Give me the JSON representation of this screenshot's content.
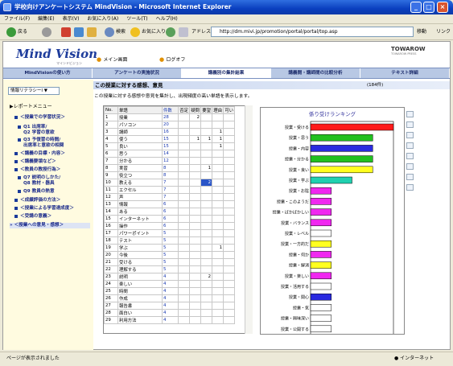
{
  "window": {
    "title": "学校向けアンケートシステム MindVision - Microsoft Internet Explorer"
  },
  "menubar": [
    "ファイル(F)",
    "編集(E)",
    "表示(V)",
    "お気に入り(A)",
    "ツール(T)",
    "ヘルプ(H)"
  ],
  "toolbar": {
    "back": "戻る",
    "search": "検索",
    "favorites": "お気に入り",
    "address_label": "アドレス(D)",
    "address": "http://dm.mivi.jp/promotion/portal/portal/top.asp",
    "go": "移動",
    "links": "リンク"
  },
  "header": {
    "logo": "Mind Vision",
    "logo_sub": "マインドビジョン",
    "menu_main": "メイン画面",
    "logout": "ログオフ",
    "brand": "TOWAROW",
    "brand_sub": "TOWAROW PRESS"
  },
  "navtabs": [
    "MindVisionの使い方",
    "アンケートの実施状況",
    "講義別の集計結果",
    "講義間・講師間の比較分析",
    "テキスト詳細"
  ],
  "sidebar": {
    "select": "情報リテラシーⅠ",
    "menu_title": "▶レポートメニュー",
    "items": [
      "＜授業での学習状況＞",
      "Q1 出席率/",
      "Q2 学習の意欲",
      "Q3 予復習の時間/",
      "出席率と意欲の相関",
      "＜講義の目標・内容＞",
      "＜講義要領など＞",
      "＜教員の教授行為＞",
      "Q7 説明のしかた/",
      "Q8 教材・器具",
      "Q9 教員の熱意",
      "＜成績評価の方法＞",
      "＜授業による学習達成度＞",
      "＜受講の意義＞",
      "＜授業への意見・感想＞"
    ]
  },
  "main": {
    "title": "この授業に対する感想、意見",
    "count": "(184件)",
    "desc": "この授業に対する感想や意見を集計し、出現頻度の高い単語を表示します。",
    "table_headers": [
      "No.",
      "単語",
      "件数",
      "否定",
      "疑問",
      "要望",
      "理由",
      "可い"
    ],
    "rows": [
      [
        "1",
        "授業",
        "28",
        "",
        "2",
        "",
        ""
      ],
      [
        "2",
        "パソコン",
        "20",
        "",
        "",
        "",
        ""
      ],
      [
        "3",
        "講師",
        "16",
        "",
        "",
        "",
        "1"
      ],
      [
        "4",
        "使う",
        "15",
        "",
        "1",
        "1",
        "1"
      ],
      [
        "5",
        "良い",
        "15",
        "",
        "",
        "",
        "1"
      ],
      [
        "6",
        "思う",
        "14",
        "",
        "",
        "",
        ""
      ],
      [
        "7",
        "分かる",
        "12",
        "",
        "",
        "",
        ""
      ],
      [
        "8",
        "実習",
        "8",
        "",
        "",
        "1",
        ""
      ],
      [
        "9",
        "役立つ",
        "8",
        "",
        "",
        "",
        ""
      ],
      [
        "10",
        "教える",
        "7",
        "",
        "",
        "2",
        ""
      ],
      [
        "11",
        "エクセル",
        "7",
        "",
        "",
        "",
        ""
      ],
      [
        "12",
        "声",
        "7",
        "",
        "",
        "",
        ""
      ],
      [
        "13",
        "情報",
        "6",
        "",
        "",
        "",
        ""
      ],
      [
        "14",
        "ある",
        "6",
        "",
        "",
        "",
        ""
      ],
      [
        "15",
        "インターネット",
        "6",
        "",
        "",
        "",
        ""
      ],
      [
        "16",
        "操作",
        "6",
        "",
        "",
        "",
        ""
      ],
      [
        "17",
        "パワーポイント",
        "5",
        "",
        "",
        "",
        ""
      ],
      [
        "18",
        "テスト",
        "5",
        "",
        "",
        "",
        ""
      ],
      [
        "19",
        "学ぶ",
        "5",
        "",
        "",
        "",
        "1"
      ],
      [
        "20",
        "今後",
        "5",
        "",
        "",
        "",
        ""
      ],
      [
        "21",
        "受ける",
        "5",
        "",
        "",
        "",
        ""
      ],
      [
        "22",
        "理解する",
        "5",
        "",
        "",
        "",
        ""
      ],
      [
        "23",
        "説明",
        "4",
        "",
        "",
        "2",
        ""
      ],
      [
        "24",
        "楽しい",
        "4",
        "",
        "",
        "",
        ""
      ],
      [
        "25",
        "時間",
        "4",
        "",
        "",
        "",
        ""
      ],
      [
        "26",
        "作成",
        "4",
        "",
        "",
        "",
        ""
      ],
      [
        "27",
        "報告書",
        "4",
        "",
        "",
        "",
        ""
      ],
      [
        "28",
        "面白い",
        "4",
        "",
        "",
        "",
        ""
      ],
      [
        "29",
        "利用方法",
        "4",
        "",
        "",
        "",
        ""
      ]
    ]
  },
  "chart_data": {
    "type": "bar",
    "title": "係り受けランキング",
    "categories": [
      "授業・受ける",
      "授業・思う",
      "授業・内容",
      "授業・分かる",
      "授業・良い",
      "授業・学ぶ",
      "授業・お陰",
      "授業・このようだ",
      "授業・ばかばかしい",
      "授業・バランス",
      "授業・レベル",
      "授業・一方的だ",
      "授業・何か",
      "授業・解消",
      "授業・楽しい",
      "授業・活用する",
      "授業・関心",
      "授業・気",
      "授業・興味深い",
      "授業・公開する"
    ],
    "values": [
      4,
      3,
      3,
      3,
      3,
      2,
      1,
      1,
      1,
      1,
      1,
      1,
      1,
      1,
      1,
      1,
      1,
      1,
      1,
      1
    ],
    "colors": [
      "#ff1a1a",
      "#20c020",
      "#2a2ae0",
      "#20c020",
      "#ffff20",
      "#20d0b0",
      "#f028f0",
      "#f028f0",
      "#f028f0",
      "#f028f0",
      "#ffffff",
      "#ffff20",
      "#f028f0",
      "#ffff20",
      "#f028f0",
      "#ffffff",
      "#2a2ae0",
      "#ffffff",
      "#ffffff",
      "#ffffff"
    ],
    "xlim": [
      0,
      4
    ],
    "xticks": [
      "0",
      "1",
      "2",
      "3",
      "4"
    ]
  },
  "status": {
    "left": "ページが表示されました",
    "right": "インターネット"
  }
}
